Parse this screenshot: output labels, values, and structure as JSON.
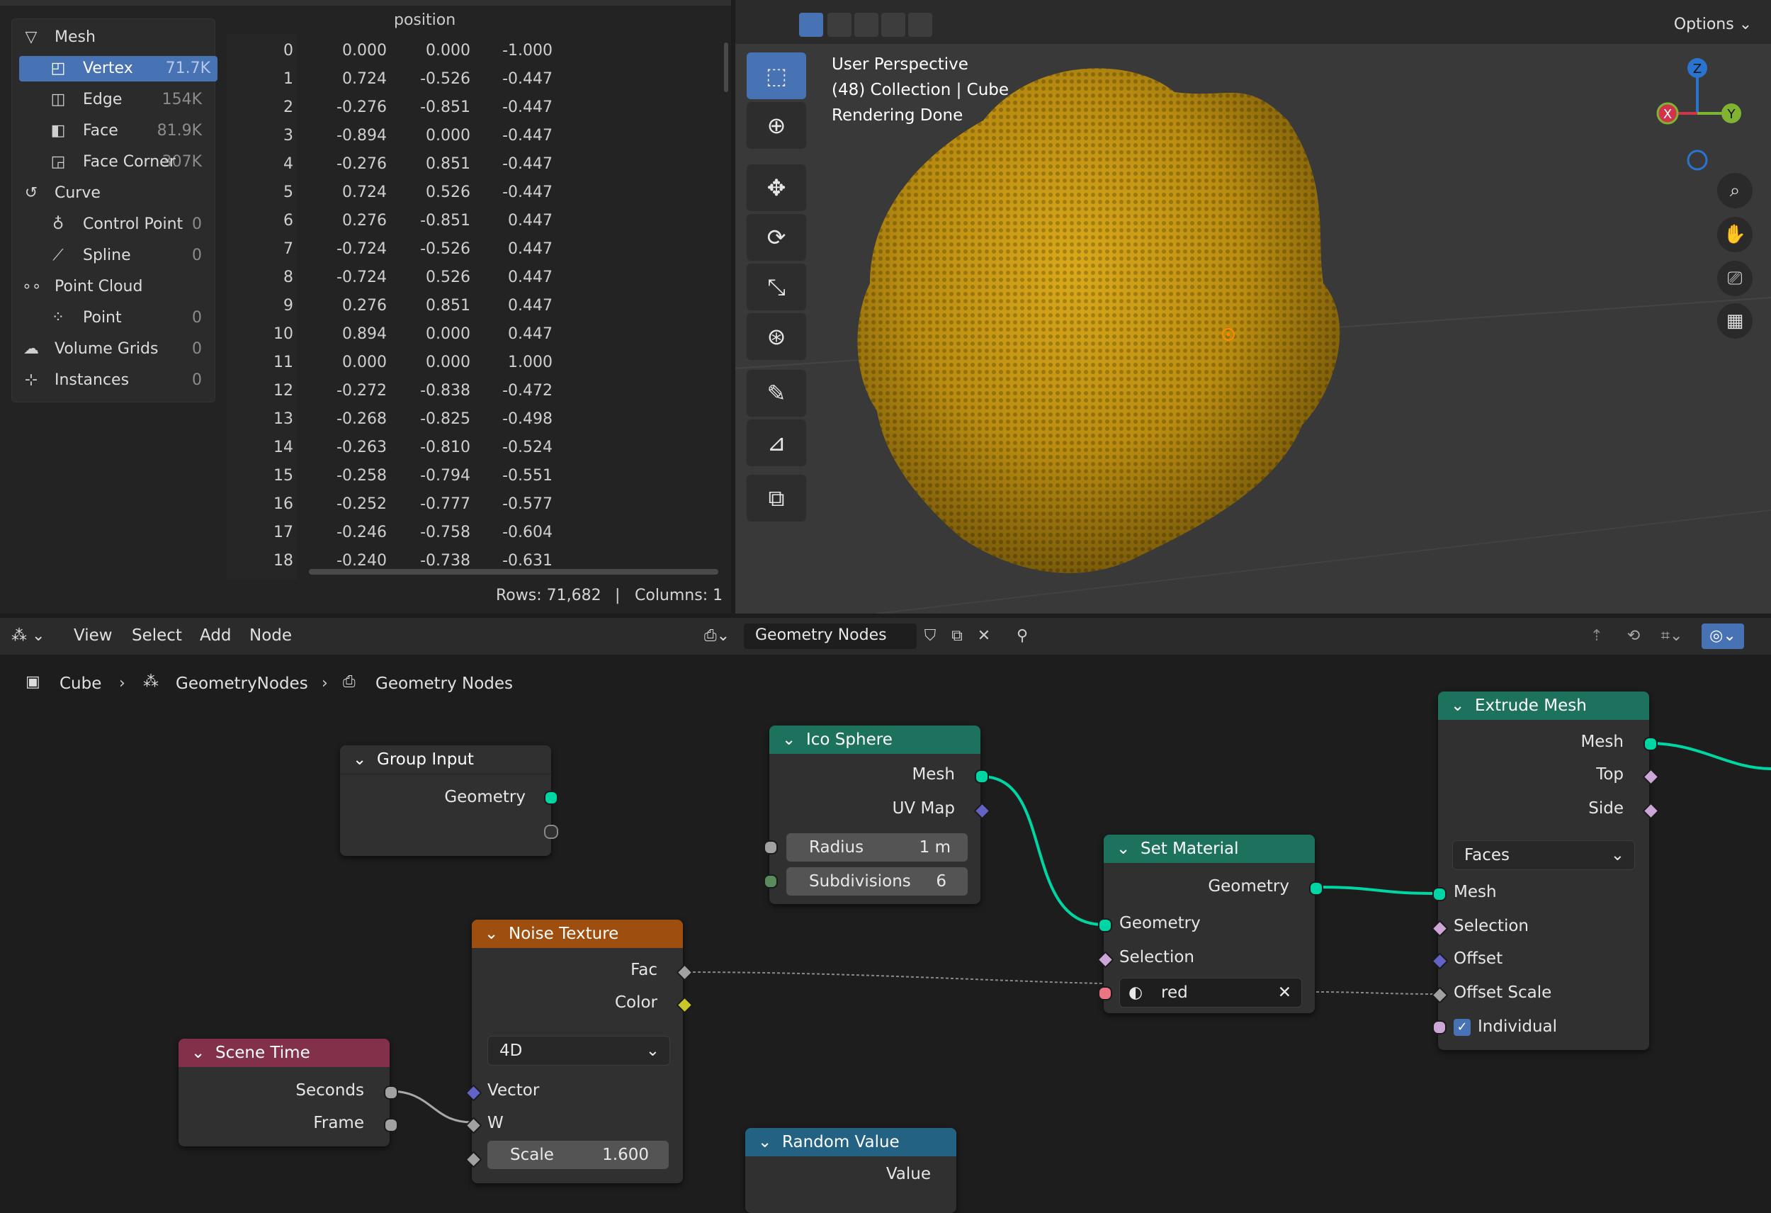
{
  "colors": {
    "accent": "#4772b3",
    "geometry_socket": "#00d6a3",
    "mesh_header": "#1d725e",
    "texture_header": "#9e4e0e",
    "input_header": "#83314a",
    "utility_header": "#246283",
    "object_color": "#c99a12"
  },
  "spreadsheet": {
    "data_sets": [
      {
        "label": "Mesh",
        "count": "",
        "icon": "mesh-icon"
      },
      {
        "label": "Vertex",
        "count": "71.7K",
        "icon": "vertex-icon"
      },
      {
        "label": "Edge",
        "count": "154K",
        "icon": "edge-icon"
      },
      {
        "label": "Face",
        "count": "81.9K",
        "icon": "face-icon"
      },
      {
        "label": "Face Corner",
        "count": "307K",
        "icon": "face-corner-icon"
      },
      {
        "label": "Curve",
        "count": "",
        "icon": "curve-icon"
      },
      {
        "label": "Control Point",
        "count": "0",
        "icon": "control-point-icon"
      },
      {
        "label": "Spline",
        "count": "0",
        "icon": "spline-icon"
      },
      {
        "label": "Point Cloud",
        "count": "",
        "icon": "point-cloud-icon"
      },
      {
        "label": "Point",
        "count": "0",
        "icon": "point-icon"
      },
      {
        "label": "Volume Grids",
        "count": "0",
        "icon": "volume-icon"
      },
      {
        "label": "Instances",
        "count": "0",
        "icon": "instances-icon"
      }
    ],
    "column_header": "position",
    "rows": [
      [
        "0",
        "0.000",
        "0.000",
        "-1.000"
      ],
      [
        "1",
        "0.724",
        "-0.526",
        "-0.447"
      ],
      [
        "2",
        "-0.276",
        "-0.851",
        "-0.447"
      ],
      [
        "3",
        "-0.894",
        "0.000",
        "-0.447"
      ],
      [
        "4",
        "-0.276",
        "0.851",
        "-0.447"
      ],
      [
        "5",
        "0.724",
        "0.526",
        "-0.447"
      ],
      [
        "6",
        "0.276",
        "-0.851",
        "0.447"
      ],
      [
        "7",
        "-0.724",
        "-0.526",
        "0.447"
      ],
      [
        "8",
        "-0.724",
        "0.526",
        "0.447"
      ],
      [
        "9",
        "0.276",
        "0.851",
        "0.447"
      ],
      [
        "10",
        "0.894",
        "0.000",
        "0.447"
      ],
      [
        "11",
        "0.000",
        "0.000",
        "1.000"
      ],
      [
        "12",
        "-0.272",
        "-0.838",
        "-0.472"
      ],
      [
        "13",
        "-0.268",
        "-0.825",
        "-0.498"
      ],
      [
        "14",
        "-0.263",
        "-0.810",
        "-0.524"
      ],
      [
        "15",
        "-0.258",
        "-0.794",
        "-0.551"
      ],
      [
        "16",
        "-0.252",
        "-0.777",
        "-0.577"
      ],
      [
        "17",
        "-0.246",
        "-0.758",
        "-0.604"
      ],
      [
        "18",
        "-0.240",
        "-0.738",
        "-0.631"
      ]
    ],
    "rows_status": "Rows: 71,682",
    "separator": "|",
    "columns_status": "Columns: 1"
  },
  "viewport": {
    "info_lines": [
      "User Perspective",
      "(48) Collection | Cube",
      "Rendering Done"
    ],
    "options_label": "Options",
    "gizmo": {
      "x": "X",
      "y": "Y",
      "z": "Z"
    }
  },
  "node_editor": {
    "menus": [
      "View",
      "Select",
      "Add",
      "Node"
    ],
    "tree_name": "Geometry Nodes",
    "breadcrumb": [
      "Cube",
      "GeometryNodes",
      "Geometry Nodes"
    ],
    "nodes": {
      "group_input": {
        "title": "Group Input",
        "geometry": "Geometry"
      },
      "ico_sphere": {
        "title": "Ico Sphere",
        "mesh": "Mesh",
        "uv_map": "UV Map",
        "radius_label": "Radius",
        "radius_value": "1 m",
        "subdiv_label": "Subdivisions",
        "subdiv_value": "6"
      },
      "set_material": {
        "title": "Set Material",
        "geometry_out": "Geometry",
        "geometry_in": "Geometry",
        "selection": "Selection",
        "material": "red"
      },
      "extrude_mesh": {
        "title": "Extrude Mesh",
        "mesh_out": "Mesh",
        "top": "Top",
        "side": "Side",
        "mode": "Faces",
        "mesh_in": "Mesh",
        "selection": "Selection",
        "offset": "Offset",
        "offset_scale": "Offset Scale",
        "individual": "Individual",
        "individual_checked": true
      },
      "noise_texture": {
        "title": "Noise Texture",
        "fac": "Fac",
        "color": "Color",
        "dimensions": "4D",
        "vector": "Vector",
        "w": "W",
        "scale_label": "Scale",
        "scale_value": "1.600"
      },
      "scene_time": {
        "title": "Scene Time",
        "seconds": "Seconds",
        "frame": "Frame"
      },
      "random_value": {
        "title": "Random Value",
        "value": "Value"
      }
    }
  }
}
